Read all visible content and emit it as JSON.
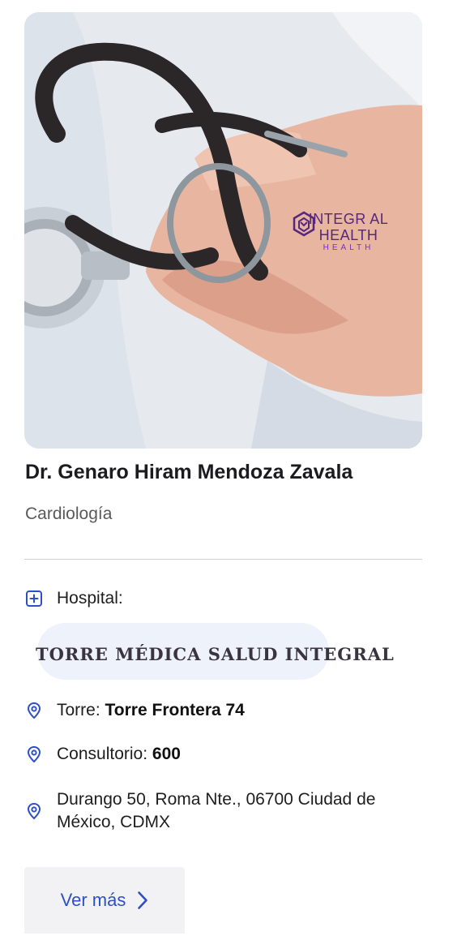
{
  "card": {
    "image_alt": "",
    "logo": {
      "line1": "INTEGR AL",
      "line2": "HEALTH",
      "line3": "HEALTH"
    },
    "doctor_name": "Dr. Genaro Hiram Mendoza Zavala",
    "specialty": "Cardiología",
    "hospital_label": "Hospital:",
    "hospital_name": "TORRE MÉDICA SALUD INTEGRAL",
    "torre_label": "Torre:",
    "torre_value": "Torre Frontera 74",
    "consultorio_label": "Consultorio:",
    "consultorio_value": "600",
    "address": "Durango 50, Roma Nte., 06700 Ciudad de México, CDMX",
    "button_label": "Ver más"
  },
  "colors": {
    "accent": "#2e4fc8",
    "logo": "#56287d",
    "pill_bg": "#eef2fa",
    "button_bg": "#f2f2f4"
  },
  "icons": {
    "hospital": "plus-square-icon",
    "location": "map-pin-icon",
    "button": "chevron-right-icon"
  }
}
